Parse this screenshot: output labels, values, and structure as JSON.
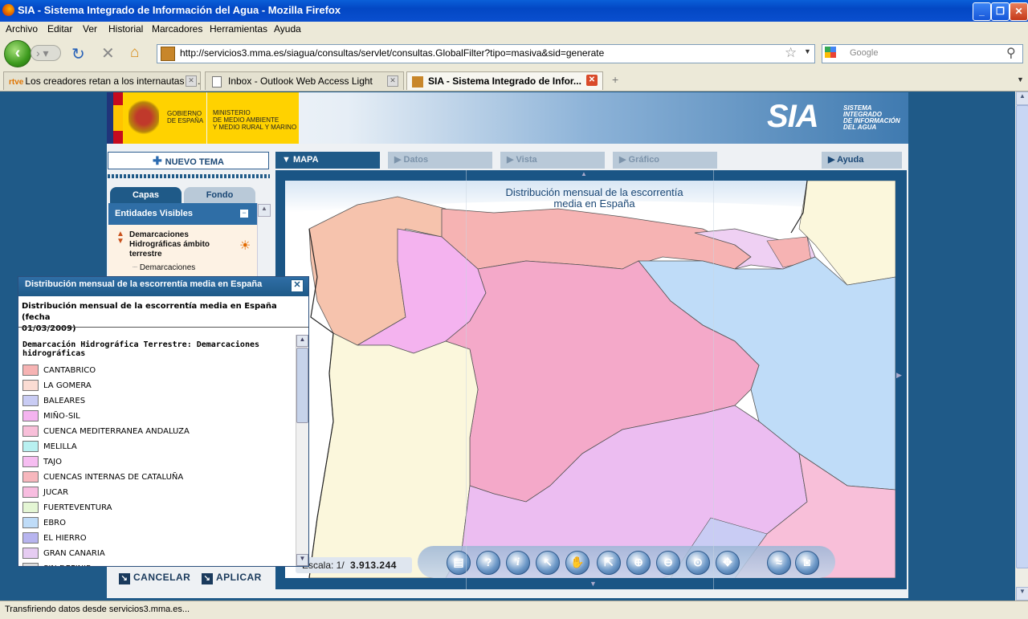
{
  "window": {
    "title": "SIA - Sistema Integrado de Información del Agua - Mozilla Firefox"
  },
  "menu": [
    "Archivo",
    "Editar",
    "Ver",
    "Historial",
    "Marcadores",
    "Herramientas",
    "Ayuda"
  ],
  "nav": {
    "url": "http://servicios3.mma.es/siagua/consultas/servlet/consultas.GlobalFilter?tipo=masiva&sid=generate",
    "search_placeholder": "Google"
  },
  "tabs": [
    {
      "label": "Los creadores retan a los internautas e..."
    },
    {
      "label": "Inbox - Outlook Web Access Light"
    },
    {
      "label": "SIA - Sistema Integrado de Infor..."
    }
  ],
  "banner": {
    "gov1": "GOBIERNO",
    "gov2": "DE ESPAÑA",
    "min1": "MINISTERIO",
    "min2": "DE MEDIO AMBIENTE",
    "min3": "Y MEDIO RURAL Y MARINO",
    "logo": "SIA",
    "logo_sub1": "SISTEMA",
    "logo_sub2": "INTEGRADO",
    "logo_sub3": "DE INFORMACIÓN",
    "logo_sub4": "DEL AGUA"
  },
  "toolbar": {
    "nuevo_tema": "NUEVO TEMA",
    "mapa": "MAPA",
    "datos": "Datos",
    "vista": "Vista",
    "grafico": "Gráfico",
    "ayuda": "Ayuda"
  },
  "sidebar": {
    "tab_capas": "Capas",
    "tab_fondo": "Fondo",
    "entidades": "Entidades Visibles",
    "layer_title1": "Demarcaciones",
    "layer_title2": "Hidrográficas ámbito",
    "layer_title3": "terrestre",
    "sublayer": "Demarcaciones"
  },
  "map": {
    "title1": "Distribución mensual de la escorrentía",
    "title2": "media en España",
    "scale_label": "Escala: 1/",
    "scale_value": "3.913.244"
  },
  "dialog": {
    "title": "Distribución mensual de la escorrentía media en España",
    "subtitle1": "Distribución mensual de la escorrentía media en España (fecha",
    "subtitle2": "01/03/2009)",
    "group1": "Demarcación Hidrográfica Terrestre: Demarcaciones",
    "group2": "hidrográficas",
    "legend": [
      {
        "label": "CANTABRICO",
        "color": "#f6b3b3"
      },
      {
        "label": "LA GOMERA",
        "color": "#fbdcd3"
      },
      {
        "label": "BALEARES",
        "color": "#c9ccf4"
      },
      {
        "label": "MIÑO-SIL",
        "color": "#f4b3ef"
      },
      {
        "label": "CUENCA MEDITERRANEA ANDALUZA",
        "color": "#f8bfd9"
      },
      {
        "label": "MELILLA",
        "color": "#b8f0f0"
      },
      {
        "label": "TAJO",
        "color": "#f6bdf1"
      },
      {
        "label": "CUENCAS INTERNAS DE CATALUÑA",
        "color": "#f7b7bd"
      },
      {
        "label": "JUCAR",
        "color": "#f8bde0"
      },
      {
        "label": "FUERTEVENTURA",
        "color": "#e4f6d4"
      },
      {
        "label": "EBRO",
        "color": "#bfdcf8"
      },
      {
        "label": "EL HIERRO",
        "color": "#b7b4ef"
      },
      {
        "label": "GRAN CANARIA",
        "color": "#e6ccf2"
      },
      {
        "label": "SIN DEFINIR",
        "color": "#dddddd"
      }
    ],
    "cancel": "CANCELAR",
    "apply": "APLICAR"
  },
  "status": {
    "text": "Transfiriendo datos desde servicios3.mma.es..."
  },
  "colors": {
    "galicia": "#f6c3ad",
    "cantabrico": "#f6b3b3",
    "mino": "#f4b3ef",
    "duero": "#f4a9c9",
    "ebro": "#bfdcf8",
    "portugal": "#fbf7dc",
    "tajo": "#ecbdf1",
    "pais_vasco": "#efd0f3"
  }
}
